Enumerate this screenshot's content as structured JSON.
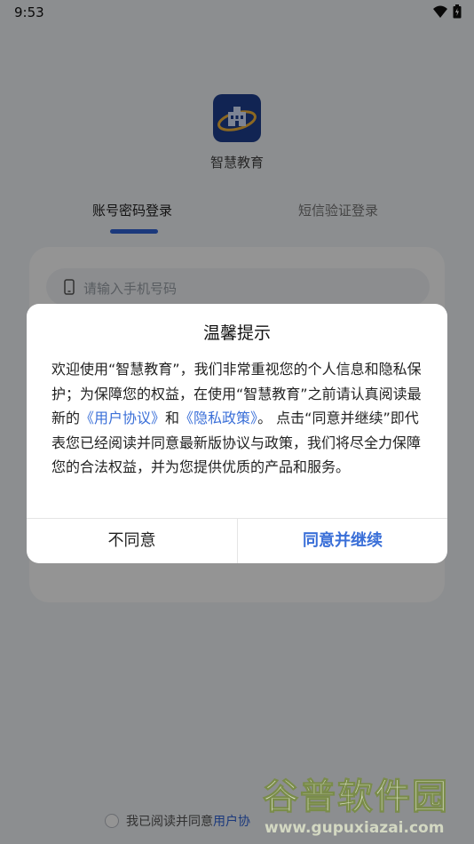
{
  "status_bar": {
    "time": "9:53"
  },
  "app": {
    "name": "智慧教育"
  },
  "tabs": [
    {
      "label": "账号密码登录",
      "active": true
    },
    {
      "label": "短信验证登录",
      "active": false
    }
  ],
  "login": {
    "phone_placeholder": "请输入手机号码"
  },
  "agreement": {
    "prefix": "我已阅读并同意",
    "link": "用户协"
  },
  "dialog": {
    "title": "温馨提示",
    "body_parts": [
      "欢迎使用“智慧教育”，我们非常重视您的个人信息和隐私保护；为保障您的权益，在使用“智慧教育”之前请认真阅读最新的",
      "《用户协议》",
      "和",
      "《隐私政策》",
      "。 点击“同意并继续”即代表您已经阅读并同意最新版协议与政策，我们将尽全力保障您的合法权益，并为您提供优质的产品和服务。"
    ],
    "disagree_label": "不同意",
    "agree_label": "同意并继续"
  },
  "watermark": {
    "title": "谷普软件园",
    "url": "www.gupuxiazai.com"
  },
  "colors": {
    "accent": "#2f63d6",
    "link": "#3a6fd8",
    "overlay": "rgba(0,0,0,0.42)"
  }
}
